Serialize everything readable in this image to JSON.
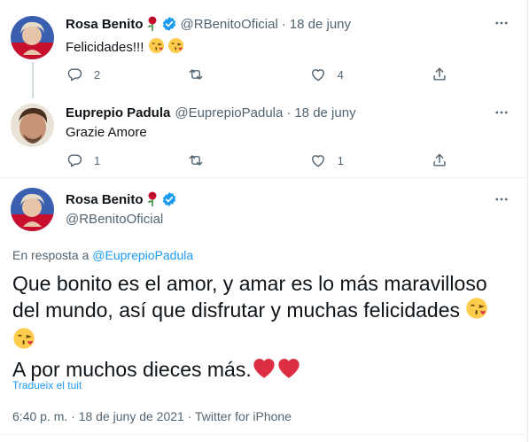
{
  "tweets": [
    {
      "name": "Rosa Benito",
      "handle": "@RBenitoOficial",
      "date": "18 de juny",
      "text": "Felicidades!!!",
      "reply_count": "2",
      "retweet_count": "",
      "like_count": "4"
    },
    {
      "name": "Euprepio Padula",
      "handle": "@EuprepioPadula",
      "date": "18 de juny",
      "text": "Grazie Amore",
      "reply_count": "1",
      "retweet_count": "",
      "like_count": "1"
    }
  ],
  "main": {
    "name": "Rosa Benito",
    "handle": "@RBenitoOficial",
    "reply_prefix": "En resposta a",
    "reply_to": "@EuprepioPadula",
    "line1": "Que bonito es el amor, y amar es lo más maravilloso",
    "line2": "del mundo, así que disfrutar y muchas felicidades",
    "line4": "A por muchos dieces más.",
    "translate": "Tradueix el tuit",
    "time": "6:40 p. m.",
    "full_date": "18 de juny de 2021",
    "source": "Twitter for iPhone"
  },
  "colors": {
    "accent": "#1d9bf0",
    "secondary_text": "#536471",
    "heart": "#e0245e"
  }
}
